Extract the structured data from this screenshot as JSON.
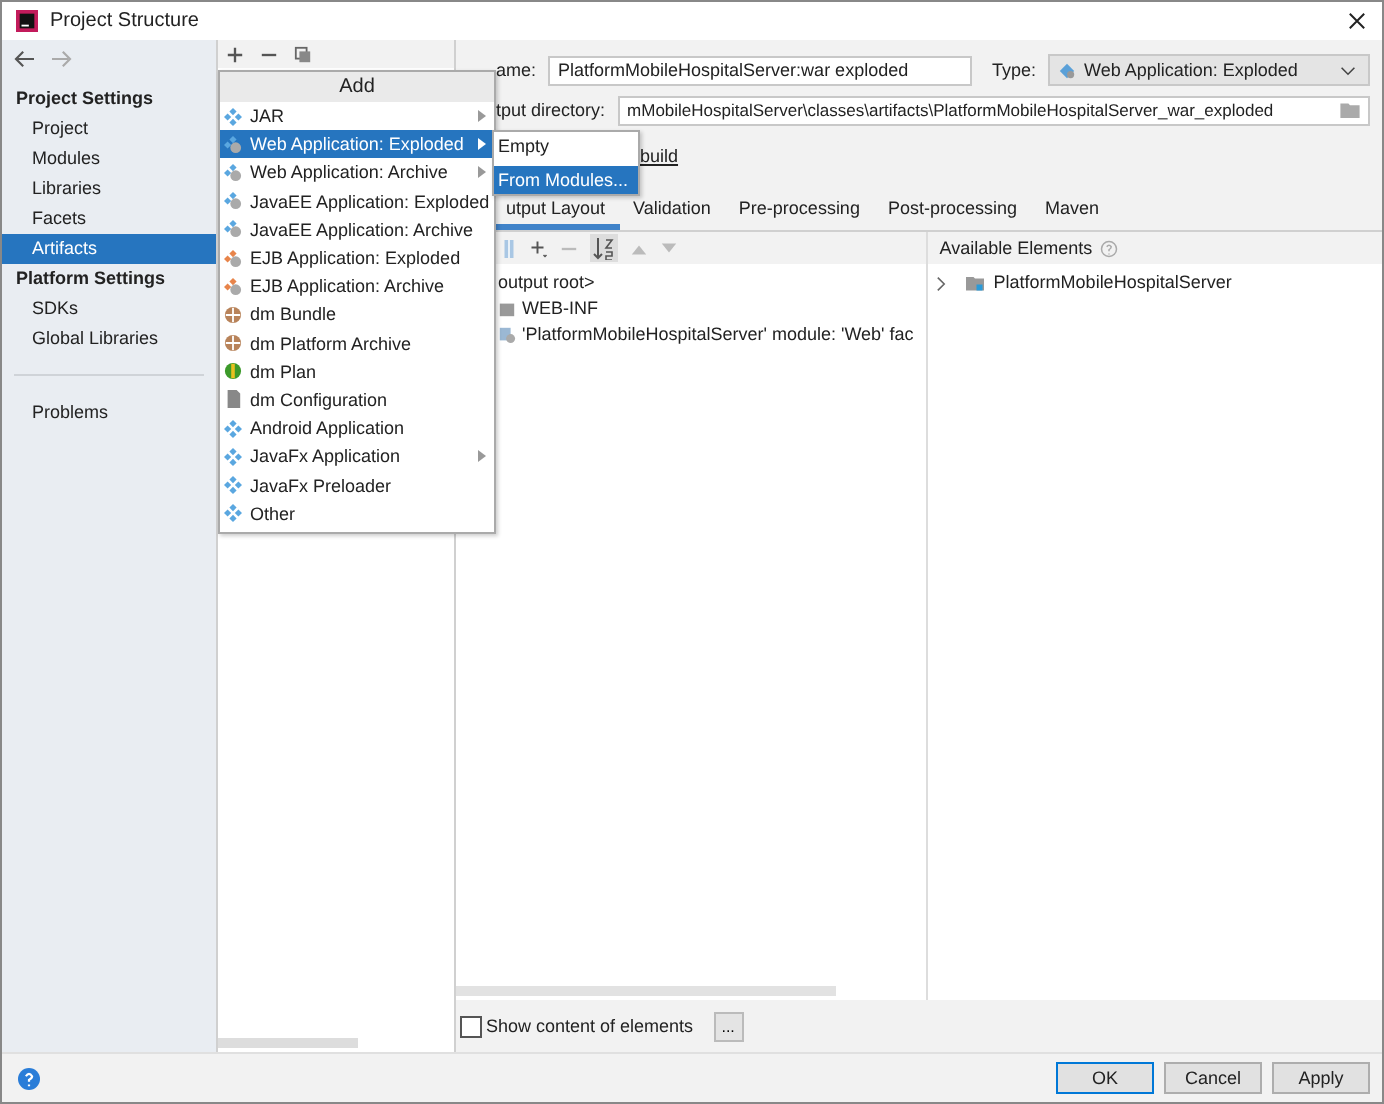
{
  "window": {
    "title": "Project Structure"
  },
  "sidebar": {
    "sections": [
      {
        "heading": "Project Settings",
        "items": [
          {
            "label": "Project",
            "selected": false
          },
          {
            "label": "Modules",
            "selected": false
          },
          {
            "label": "Libraries",
            "selected": false
          },
          {
            "label": "Facets",
            "selected": false
          },
          {
            "label": "Artifacts",
            "selected": true
          }
        ]
      },
      {
        "heading": "Platform Settings",
        "items": [
          {
            "label": "SDKs",
            "selected": false
          },
          {
            "label": "Global Libraries",
            "selected": false
          }
        ]
      }
    ],
    "footer_items": [
      {
        "label": "Problems",
        "selected": false
      }
    ]
  },
  "add_menu": {
    "title": "Add",
    "items": [
      {
        "label": "JAR",
        "kind": "diamond",
        "has_submenu": true,
        "selected": false
      },
      {
        "label": "Web Application: Exploded",
        "kind": "web",
        "has_submenu": true,
        "selected": true
      },
      {
        "label": "Web Application: Archive",
        "kind": "web",
        "has_submenu": true,
        "selected": false
      },
      {
        "label": "JavaEE Application: Exploded",
        "kind": "web",
        "has_submenu": false,
        "selected": false
      },
      {
        "label": "JavaEE Application: Archive",
        "kind": "web",
        "has_submenu": false,
        "selected": false
      },
      {
        "label": "EJB Application: Exploded",
        "kind": "ejb",
        "has_submenu": false,
        "selected": false
      },
      {
        "label": "EJB Application: Archive",
        "kind": "ejb",
        "has_submenu": false,
        "selected": false
      },
      {
        "label": "dm Bundle",
        "kind": "bundle",
        "has_submenu": false,
        "selected": false
      },
      {
        "label": "dm Platform Archive",
        "kind": "bundle",
        "has_submenu": false,
        "selected": false
      },
      {
        "label": "dm Plan",
        "kind": "plan",
        "has_submenu": false,
        "selected": false
      },
      {
        "label": "dm Configuration",
        "kind": "config",
        "has_submenu": false,
        "selected": false
      },
      {
        "label": "Android Application",
        "kind": "diamond",
        "has_submenu": false,
        "selected": false
      },
      {
        "label": "JavaFx Application",
        "kind": "diamond",
        "has_submenu": true,
        "selected": false
      },
      {
        "label": "JavaFx Preloader",
        "kind": "diamond",
        "has_submenu": false,
        "selected": false
      },
      {
        "label": "Other",
        "kind": "diamond",
        "has_submenu": false,
        "selected": false
      }
    ]
  },
  "submenu": {
    "items": [
      {
        "label": "Empty",
        "selected": false
      },
      {
        "label": "From Modules...",
        "selected": true
      }
    ]
  },
  "artifact": {
    "name_label": "ame:",
    "name": "PlatformMobileHospitalServer:war exploded",
    "type_label": "Type:",
    "type": "Web Application: Exploded",
    "output_label": "tput directory:",
    "output_directory": "mMobileHospitalServer\\classes\\artifacts\\PlatformMobileHospitalServer_war_exploded",
    "include_label": "build",
    "tabs": [
      {
        "label": "utput Layout",
        "selected": true
      },
      {
        "label": "Validation",
        "selected": false
      },
      {
        "label": "Pre-processing",
        "selected": false
      },
      {
        "label": "Post-processing",
        "selected": false
      },
      {
        "label": "Maven",
        "selected": false
      }
    ],
    "layout_tree": [
      {
        "label": "output root>",
        "kind": "root"
      },
      {
        "label": "WEB-INF",
        "kind": "folder"
      },
      {
        "label": "'PlatformMobileHospitalServer' module: 'Web' fac",
        "kind": "facet"
      }
    ],
    "available_label": "Available Elements",
    "available_tree": [
      {
        "label": "PlatformMobileHospitalServer",
        "expanded": false
      }
    ],
    "show_content": {
      "label": "Show content of elements",
      "checked": false
    },
    "more_button": "..."
  },
  "buttons": [
    {
      "label": "OK",
      "default": true
    },
    {
      "label": "Cancel",
      "default": false
    },
    {
      "label": "Apply",
      "default": false
    }
  ]
}
